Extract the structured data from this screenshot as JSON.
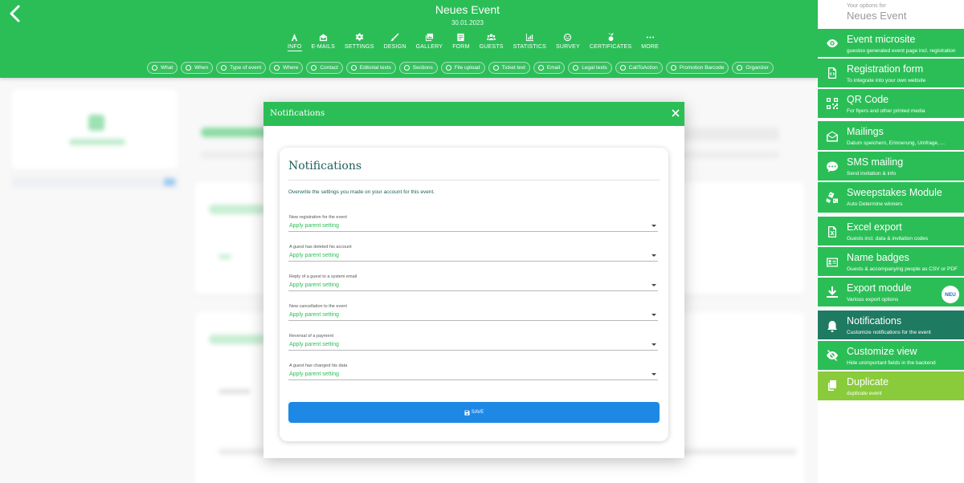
{
  "header": {
    "title": "Neues Event",
    "date": "30.01.2023",
    "nav": [
      {
        "label": "INFO",
        "icon": "text-icon"
      },
      {
        "label": "E-MAILS",
        "icon": "envelope-icon"
      },
      {
        "label": "SETTINGS",
        "icon": "gear-icon"
      },
      {
        "label": "DESIGN",
        "icon": "brush-icon"
      },
      {
        "label": "GALLERY",
        "icon": "images-icon"
      },
      {
        "label": "FORM",
        "icon": "form-icon"
      },
      {
        "label": "GUESTS",
        "icon": "users-icon"
      },
      {
        "label": "STATISTICS",
        "icon": "chart-icon"
      },
      {
        "label": "SURVEY",
        "icon": "smile-icon"
      },
      {
        "label": "CERTIFICATES",
        "icon": "medal-icon"
      },
      {
        "label": "MORE",
        "icon": "dots-icon"
      }
    ],
    "subnav": [
      "What",
      "When",
      "Type of event",
      "Where",
      "Contact",
      "Editorial texts",
      "Sections",
      "File upload",
      "Ticket text",
      "Email",
      "Legal texts",
      "CallToAction",
      "Promotion Barcode",
      "Organizer"
    ]
  },
  "modal": {
    "title": "Notifications",
    "card_title": "Notifications",
    "description": "Overwrite the settings you made on your account for this event.",
    "fields": [
      {
        "label": "New registration for the event",
        "value": "Apply parent setting"
      },
      {
        "label": "A guest has deleted his account",
        "value": "Apply parent setting"
      },
      {
        "label": "Reply of a guest to a system email",
        "value": "Apply parent setting"
      },
      {
        "label": "New cancellation to the event",
        "value": "Apply parent setting"
      },
      {
        "label": "Reversal of a payment",
        "value": "Apply parent setting"
      },
      {
        "label": "A guest has changed his data",
        "value": "Apply parent setting"
      }
    ],
    "save_label": "SAVE"
  },
  "panel": {
    "small": "Your options for",
    "big": "Neues Event",
    "items": [
      {
        "title": "Event microsite",
        "subtitle": "guestoo generated event page incl. registration",
        "icon": "eye-icon"
      },
      {
        "title": "Registration form",
        "subtitle": "To integrate into your own website",
        "icon": "code-file-icon"
      },
      {
        "title": "QR Code",
        "subtitle": "For flyers and other printed media",
        "icon": "qr-code-icon"
      },
      {
        "title": "Mailings",
        "subtitle": "Datum speichern, Erinnerung, Umfrage, ...",
        "icon": "envelope-open-icon"
      },
      {
        "title": "SMS mailing",
        "subtitle": "Send invitation & info",
        "icon": "sms-icon"
      },
      {
        "title": "Sweepstakes Module",
        "subtitle": "Auto Determine winners",
        "icon": "dice-icon"
      },
      {
        "title": "Excel export",
        "subtitle": "Guests incl. data & invitation codes",
        "icon": "excel-file-icon"
      },
      {
        "title": "Name badges",
        "subtitle": "Guests & accompanying people as CSV or PDF",
        "icon": "badge-icon"
      },
      {
        "title": "Export module",
        "subtitle": "Various export options",
        "icon": "download-icon",
        "badge": "NEU"
      },
      {
        "title": "Notifications",
        "subtitle": "Customize notifications for the event",
        "icon": "bell-icon"
      },
      {
        "title": "Customize view",
        "subtitle": "Hide unimportant fields in the backend",
        "icon": "eye-slash-icon"
      },
      {
        "title": "Duplicate",
        "subtitle": "duplicate event",
        "icon": "copy-icon"
      }
    ]
  },
  "colors": {
    "brand_green": "#2bbe57",
    "active_teal": "#1f7a62",
    "lime": "#8acb3c",
    "save_blue": "#1e88e5"
  }
}
